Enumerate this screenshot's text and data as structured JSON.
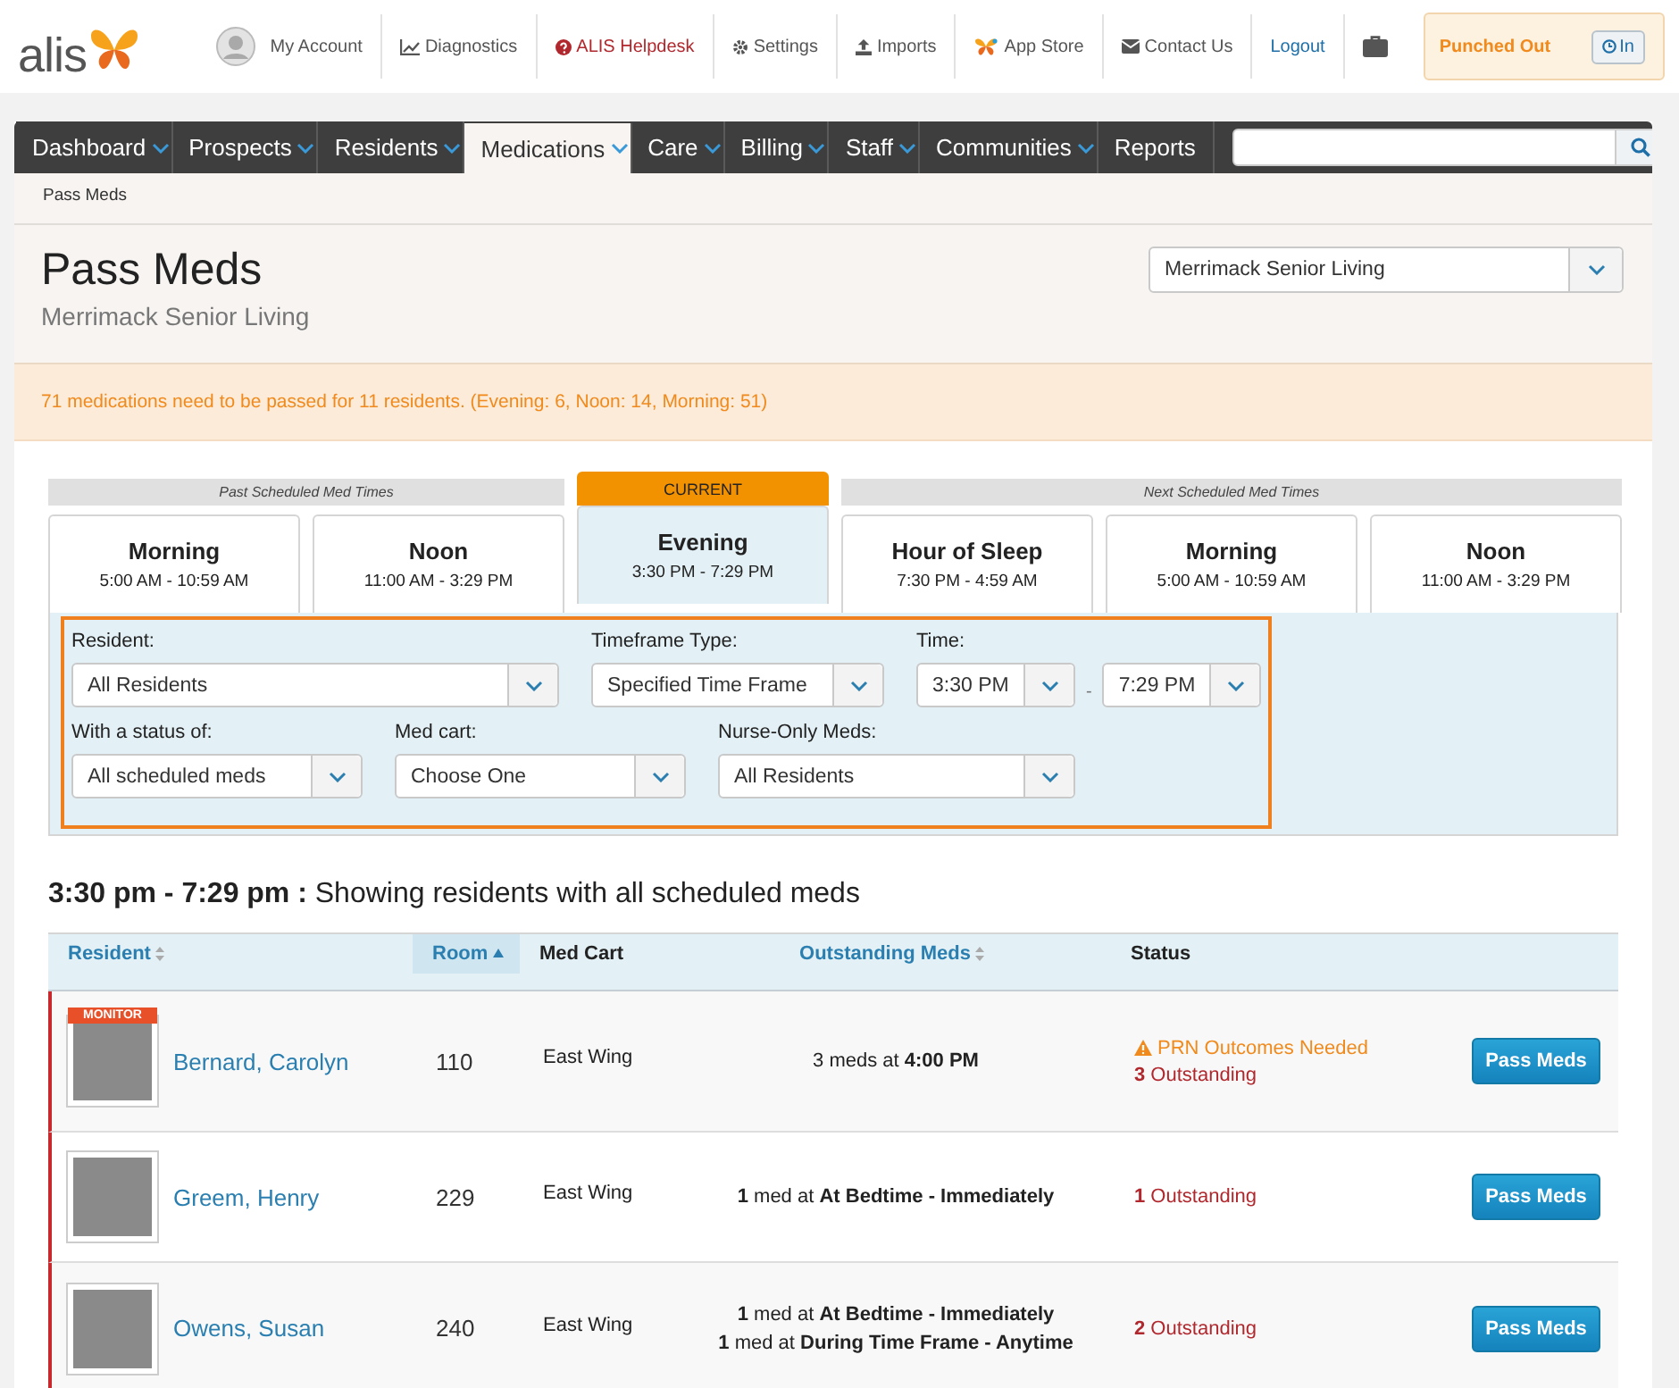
{
  "header": {
    "logo": "alis",
    "links": [
      {
        "kind": "account",
        "label": "My Account"
      },
      {
        "kind": "chart",
        "label": "Diagnostics"
      },
      {
        "kind": "help",
        "label": "ALIS Helpdesk"
      },
      {
        "kind": "gear",
        "label": "Settings"
      },
      {
        "kind": "upload",
        "label": "Imports"
      },
      {
        "kind": "store",
        "label": "App Store"
      },
      {
        "kind": "mail",
        "label": "Contact Us"
      },
      {
        "kind": "logout",
        "label": "Logout"
      },
      {
        "kind": "briefcase"
      }
    ],
    "punch": {
      "status": "Punched Out",
      "button": "In"
    }
  },
  "nav": {
    "tabs": [
      {
        "label": "Dashboard",
        "dropdown": true,
        "selected": false
      },
      {
        "label": "Prospects",
        "dropdown": true,
        "selected": false
      },
      {
        "label": "Residents",
        "dropdown": true,
        "selected": false
      },
      {
        "label": "Medications",
        "dropdown": true,
        "selected": true
      },
      {
        "label": "Care",
        "dropdown": true,
        "selected": false
      },
      {
        "label": "Billing",
        "dropdown": true,
        "selected": false
      },
      {
        "label": "Staff",
        "dropdown": true,
        "selected": false
      },
      {
        "label": "Communities",
        "dropdown": true,
        "selected": false
      },
      {
        "label": "Reports",
        "dropdown": false,
        "selected": false
      }
    ]
  },
  "breadcrumb": "Pass Meds",
  "page": {
    "title": "Pass Meds",
    "subtitle": "Merrimack Senior Living",
    "community": "Merrimack Senior Living"
  },
  "alert": "71 medications need to be passed for 11 residents. (Evening: 6, Noon: 14, Morning: 51)",
  "schedule": {
    "groups": [
      {
        "kind": "past",
        "label": "Past Scheduled Med Times",
        "slots": [
          {
            "name": "Morning",
            "time": "5:00 AM - 10:59 AM",
            "selected": false
          },
          {
            "name": "Noon",
            "time": "11:00 AM - 3:29 PM",
            "selected": false
          }
        ]
      },
      {
        "kind": "current",
        "label": "CURRENT",
        "slots": [
          {
            "name": "Evening",
            "time": "3:30 PM - 7:29 PM",
            "selected": true
          }
        ]
      },
      {
        "kind": "next",
        "label": "Next Scheduled Med Times",
        "slots": [
          {
            "name": "Hour of Sleep",
            "time": "7:30 PM - 4:59 AM",
            "selected": false
          },
          {
            "name": "Morning",
            "time": "5:00 AM - 10:59 AM",
            "selected": false
          },
          {
            "name": "Noon",
            "time": "11:00 AM - 3:29 PM",
            "selected": false
          }
        ]
      }
    ]
  },
  "filters": {
    "resident": {
      "label": "Resident:",
      "value": "All Residents"
    },
    "timeframe_type": {
      "label": "Timeframe Type:",
      "value": "Specified Time Frame"
    },
    "time": {
      "label": "Time:",
      "from": "3:30 PM",
      "separator": "-",
      "to": "7:29 PM"
    },
    "status": {
      "label": "With a status of:",
      "value": "All scheduled meds"
    },
    "med_cart": {
      "label": "Med cart:",
      "value": "Choose One"
    },
    "nurse_only": {
      "label": "Nurse-Only Meds:",
      "value": "All Residents"
    }
  },
  "results_heading": "**3:30 pm - 7:29 pm :** Showing residents with all scheduled meds",
  "table": {
    "columns": [
      {
        "label": "Resident",
        "sortable": true,
        "selected": false
      },
      {
        "label": "Room",
        "sortable": true,
        "selected": true
      },
      {
        "label": "Med Cart",
        "sortable": false,
        "selected": false
      },
      {
        "label": "Outstanding Meds",
        "sortable": true,
        "selected": false
      },
      {
        "label": "Status",
        "sortable": false,
        "selected": false
      }
    ],
    "rows": [
      {
        "badge": "MONITOR",
        "name": "Bernard, Carolyn",
        "room": "110",
        "cart": "East Wing",
        "meds": [
          "3 meds at **4:00 PM**"
        ],
        "warning": "PRN Outcomes Needed",
        "outstanding": "**3** Outstanding",
        "action": "Pass Meds"
      },
      {
        "name": "Greem, Henry",
        "room": "229",
        "cart": "East Wing",
        "meds": [
          "**1** med at **At Bedtime - Immediately**"
        ],
        "outstanding": "**1** Outstanding",
        "action": "Pass Meds"
      },
      {
        "name": "Owens, Susan",
        "room": "240",
        "cart": "East Wing",
        "meds": [
          "**1** med at **At Bedtime - Immediately**",
          "**1** med at **During Time Frame - Anytime**"
        ],
        "outstanding": "**2** Outstanding",
        "action": "Pass Meds"
      }
    ]
  }
}
